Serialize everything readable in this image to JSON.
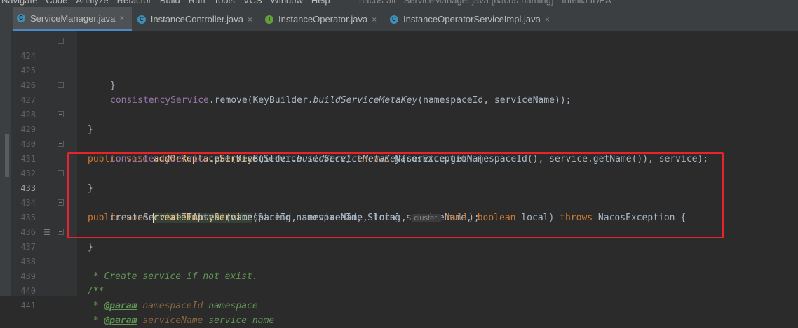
{
  "menubar": {
    "items": [
      "Navigate",
      "Code",
      "Analyze",
      "Refactor",
      "Build",
      "Run",
      "Tools",
      "VCS",
      "Window",
      "Help"
    ],
    "window_title": "nacos-all - ServiceManager.java [nacos-naming] - IntelliJ IDEA"
  },
  "tabs": [
    {
      "label": "ServiceManager.java",
      "icon": "class-icon",
      "active": true,
      "close": "×"
    },
    {
      "label": "InstanceController.java",
      "icon": "class-icon",
      "active": false,
      "close": "×"
    },
    {
      "label": "InstanceOperator.java",
      "icon": "interface-icon",
      "active": false,
      "close": "×"
    },
    {
      "label": "InstanceOperatorServiceImpl.java",
      "icon": "class-icon",
      "active": false,
      "close": "×"
    }
  ],
  "icon_letters": {
    "class": "C",
    "interface": "I"
  },
  "colors": {
    "keyword": "#cc7832",
    "method": "#ffc66d",
    "field": "#9876aa",
    "text": "#a9b7c6",
    "comment": "#629755",
    "highlight_box": "#e8232b"
  },
  "lines": {
    "l424": {
      "num": "424",
      "brace": "}"
    },
    "l425": {
      "num": "425"
    },
    "l426": {
      "num": "426",
      "field": "consistencyService",
      "t1": ".remove(KeyBuilder.",
      "m": "buildServiceMetaKey",
      "t2": "(namespaceId, serviceName));"
    },
    "l427": {
      "num": "427",
      "brace": "}"
    },
    "l428": {
      "num": "428"
    },
    "l429": {
      "num": "429",
      "kw1": "public void ",
      "fn": "addOrReplaceService",
      "t1": "(Service service) ",
      "kw2": "throws",
      "t2": " NacosException {"
    },
    "l430": {
      "num": "430",
      "field": "consistencyService",
      "t1": ".put(KeyBuilder.",
      "m": "buildServiceMetaKey",
      "t2": "(service.getNamespaceId(), service.getName()), service);"
    },
    "l431": {
      "num": "431",
      "brace": "}"
    },
    "l432": {
      "num": "432"
    },
    "l433": {
      "num": "433",
      "kw1": "public void ",
      "fn": "createEmptyService",
      "t1": "(String namespaceId, String serviceName, ",
      "kw2": "boolean",
      "t2": " local) ",
      "kw3": "throws",
      "t3": " NacosException {"
    },
    "l434": {
      "num": "434",
      "t1": "createServiceIfAbsent(namespaceId, serviceName, local, ",
      "hint": "cluster:",
      "kw": " null",
      "t2": ");"
    },
    "l435": {
      "num": "435",
      "brace": "}"
    },
    "l436": {
      "num": "436"
    },
    "l437": {
      "num": "437",
      "cmt": "/**"
    },
    "l438": {
      "num": "438",
      "cmt": " * Create service if not exist."
    },
    "l439": {
      "num": "439",
      "cmt": " *"
    },
    "l440": {
      "num": "440",
      "star": " * ",
      "tag": "@param",
      "ref": " namespaceId",
      "rest": " namespace"
    },
    "l441": {
      "num": "441",
      "star": " * ",
      "tag": "@param",
      "ref": " serviceName",
      "rest": " service name"
    }
  }
}
